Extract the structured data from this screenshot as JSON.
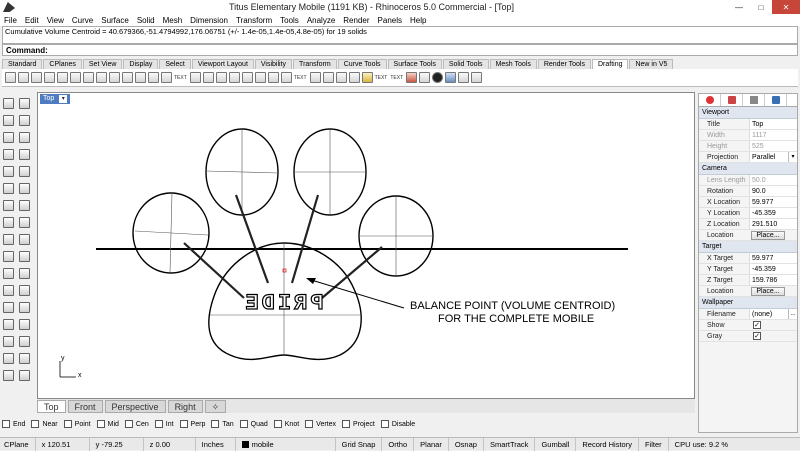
{
  "window": {
    "title": "Titus Elementary Mobile (1191 KB) - Rhinoceros 5.0 Commercial - [Top]",
    "min": "—",
    "max": "□",
    "close": "✕"
  },
  "menu": [
    "File",
    "Edit",
    "View",
    "Curve",
    "Surface",
    "Solid",
    "Mesh",
    "Dimension",
    "Transform",
    "Tools",
    "Analyze",
    "Render",
    "Panels",
    "Help"
  ],
  "command": {
    "history": "Cumulative Volume Centroid = 40.679366,-51.4794992,176.06751 (+/- 1.4e-05,1.4e-05,4.8e-05) for 19 solids",
    "label": "Command:"
  },
  "toolbar_tabs": [
    "Standard",
    "CPlanes",
    "Set View",
    "Display",
    "Select",
    "Viewport Layout",
    "Visibility",
    "Transform",
    "Curve Tools",
    "Surface Tools",
    "Solid Tools",
    "Mesh Tools",
    "Render Tools",
    "Drafting",
    "New in V5"
  ],
  "active_toolbar_tab": "Drafting",
  "toolbar_texts": [
    "TEXT",
    "TEXT",
    "TEXT",
    "TEXT"
  ],
  "viewport": {
    "name": "Top",
    "caret": "▾",
    "pride_text": "PRIDE",
    "annotation_line1": "BALANCE POINT (VOLUME CENTROID)",
    "annotation_line2": "FOR THE COMPLETE MOBILE",
    "axis_x": "x",
    "axis_y": "y"
  },
  "view_tabs": [
    "Top",
    "Front",
    "Perspective",
    "Right"
  ],
  "view_tab_add": "✧",
  "osnaps": [
    "End",
    "Near",
    "Point",
    "Mid",
    "Cen",
    "Int",
    "Perp",
    "Tan",
    "Quad",
    "Knot",
    "Vertex",
    "Project",
    "Disable"
  ],
  "status": {
    "cplane": "CPlane",
    "x": "x 120.51",
    "y": "y -79.25",
    "z": "z 0.00",
    "units": "Inches",
    "layer": "mobile",
    "toggles": [
      "Grid Snap",
      "Ortho",
      "Planar",
      "Osnap",
      "SmartTrack",
      "Gumball",
      "Record History",
      "Filter"
    ],
    "cpu": "CPU use: 9.2 %"
  },
  "properties": {
    "viewport_section": "Viewport",
    "rows_viewport": [
      {
        "label": "Title",
        "value": "Top",
        "dim": false
      },
      {
        "label": "Width",
        "value": "1117",
        "dim": true
      },
      {
        "label": "Height",
        "value": "525",
        "dim": true
      },
      {
        "label": "Projection",
        "value": "Parallel",
        "dim": false
      }
    ],
    "camera_section": "Camera",
    "rows_camera": [
      {
        "label": "Lens Length",
        "value": "50.0",
        "dim": true
      },
      {
        "label": "Rotation",
        "value": "90.0",
        "dim": false
      },
      {
        "label": "X Location",
        "value": "59.977",
        "dim": false
      },
      {
        "label": "Y Location",
        "value": "-45.359",
        "dim": false
      },
      {
        "label": "Z Location",
        "value": "291.510",
        "dim": false
      }
    ],
    "camera_location_label": "Location",
    "place_button": "Place...",
    "target_section": "Target",
    "rows_target": [
      {
        "label": "X Target",
        "value": "59.977",
        "dim": false
      },
      {
        "label": "Y Target",
        "value": "-45.359",
        "dim": false
      },
      {
        "label": "Z Target",
        "value": "159.786",
        "dim": false
      }
    ],
    "target_location_label": "Location",
    "wallpaper_section": "Wallpaper",
    "filename_label": "Filename",
    "filename_value": "(none)",
    "filename_btn": "...",
    "show_label": "Show",
    "gray_label": "Gray",
    "check_mark": "✓"
  }
}
